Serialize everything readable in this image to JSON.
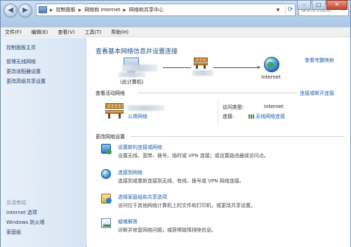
{
  "breadcrumb": {
    "items": [
      "控制面板",
      "网络和 Internet",
      "网络和共享中心"
    ],
    "search_placeholder": "搜索控制面板"
  },
  "menubar": {
    "items": [
      "文件(F)",
      "编辑(E)",
      "查看(V)",
      "工具(T)",
      "帮助(H)"
    ]
  },
  "sidebar": {
    "items": [
      "控制面板主页",
      "管理无线网络",
      "更改适配器设置",
      "更改高级共享设置"
    ],
    "see_also_title": "另请参阅",
    "see_also": [
      "Internet 选项",
      "Windows 防火墙",
      "家庭组"
    ]
  },
  "main": {
    "title": "查看基本网络信息并设置连接",
    "view_full_map": "查看完整映射",
    "map": {
      "computer_label": "(此计算机)",
      "internet_label": "Internet"
    },
    "active_networks": {
      "title": "查看活动网络",
      "connect_disconnect": "连接或断开连接",
      "network_type": "公用网络",
      "access_type_label": "访问类型:",
      "access_type_value": "Internet",
      "connection_label": "连接:",
      "connection_value": "无线网络连接"
    },
    "change_settings": {
      "title": "更改网络设置",
      "tasks": [
        {
          "label": "设置新的连接或网络",
          "desc": "设置无线、宽带、拨号、临时或 VPN 连接；或设置路由器或访问点。"
        },
        {
          "label": "连接到网络",
          "desc": "连接到或重新连接到无线、有线、拨号或 VPN 网络连接。"
        },
        {
          "label": "选择家庭组和共享选项",
          "desc": "访问位于其他网络计算机上的文件和打印机，或更改共享设置。"
        },
        {
          "label": "疑难解答",
          "desc": "诊断并修复网络问题，或获得故障排除信息。"
        }
      ]
    }
  }
}
